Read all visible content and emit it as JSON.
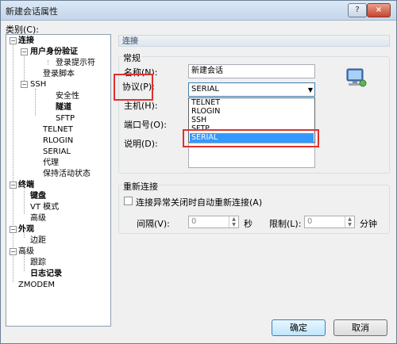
{
  "window": {
    "title": "新建会话属性",
    "help_label": "?",
    "close_label": "×"
  },
  "category_label": "类别(C):",
  "tree": {
    "connection": "连接",
    "auth": "用户身份验证",
    "login_prompt": "登录提示符",
    "login_script": "登录脚本",
    "ssh": "SSH",
    "security": "安全性",
    "tunnel": "隧道",
    "sftp": "SFTP",
    "telnet": "TELNET",
    "rlogin": "RLOGIN",
    "serial": "SERIAL",
    "proxy": "代理",
    "keepalive": "保持活动状态",
    "terminal": "终端",
    "keyboard": "键盘",
    "vt_mode": "VT 模式",
    "advanced": "高级",
    "appearance": "外观",
    "margins": "边距",
    "advanced2": "高级",
    "trace": "跟踪",
    "logging": "日志记录",
    "zmodem": "ZMODEM"
  },
  "section_title": "连接",
  "general": {
    "group_label": "常规",
    "name_label": "名称(N):",
    "name_value": "新建会话",
    "protocol_label": "协议(P):",
    "protocol_value": "SERIAL",
    "host_label": "主机(H):",
    "port_label": "端口号(O):",
    "desc_label": "说明(D):",
    "protocol_options": [
      "TELNET",
      "RLOGIN",
      "SSH",
      "SFTP",
      "SERIAL"
    ]
  },
  "reconnect": {
    "group_label": "重新连接",
    "checkbox_label": "连接异常关闭时自动重新连接(A)",
    "interval_label": "间隔(V):",
    "interval_value": "0",
    "seconds_unit": "秒",
    "limit_label": "限制(L):",
    "limit_value": "0",
    "minutes_unit": "分钟"
  },
  "buttons": {
    "ok": "确定",
    "cancel": "取消"
  },
  "colors": {
    "highlight_box": "#e0312c",
    "selection": "#3399ff"
  }
}
